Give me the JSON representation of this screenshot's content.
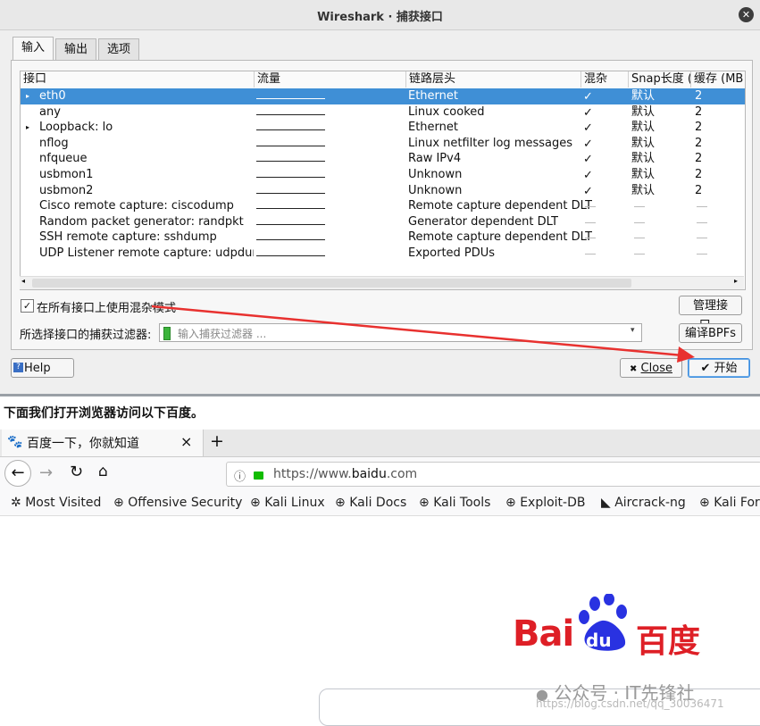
{
  "dialog": {
    "title": "Wireshark · 捕获接口",
    "tabs": [
      {
        "label": "输入"
      },
      {
        "label": "输出"
      },
      {
        "label": "选项"
      }
    ],
    "columns": {
      "interface": "接口",
      "traffic": "流量",
      "link_layer": "链路层头",
      "promiscuous": "混杂",
      "snaplen": "Snap长度 (B",
      "buffer": "缓存 (MB"
    },
    "rows": [
      {
        "expand": "▸",
        "name": "eth0",
        "link": "Ethernet",
        "promisc": "✓",
        "snap": "默认",
        "buffer": "2",
        "selected": true
      },
      {
        "expand": "",
        "name": "any",
        "link": "Linux cooked",
        "promisc": "✓",
        "snap": "默认",
        "buffer": "2"
      },
      {
        "expand": "▸",
        "name": "Loopback: lo",
        "link": "Ethernet",
        "promisc": "✓",
        "snap": "默认",
        "buffer": "2"
      },
      {
        "expand": "",
        "name": "nflog",
        "link": "Linux netfilter log messages",
        "promisc": "✓",
        "snap": "默认",
        "buffer": "2"
      },
      {
        "expand": "",
        "name": "nfqueue",
        "link": "Raw IPv4",
        "promisc": "✓",
        "snap": "默认",
        "buffer": "2"
      },
      {
        "expand": "",
        "name": "usbmon1",
        "link": "Unknown",
        "promisc": "✓",
        "snap": "默认",
        "buffer": "2"
      },
      {
        "expand": "",
        "name": "usbmon2",
        "link": "Unknown",
        "promisc": "✓",
        "snap": "默认",
        "buffer": "2"
      },
      {
        "expand": "",
        "name": "Cisco remote capture: ciscodump",
        "link": "Remote capture dependent DLT",
        "promisc": "",
        "snap": "",
        "buffer": ""
      },
      {
        "expand": "",
        "name": "Random packet generator: randpkt",
        "link": "Generator dependent DLT",
        "promisc": "",
        "snap": "",
        "buffer": ""
      },
      {
        "expand": "",
        "name": "SSH remote capture: sshdump",
        "link": "Remote capture dependent DLT",
        "promisc": "",
        "snap": "",
        "buffer": ""
      },
      {
        "expand": "",
        "name": "UDP Listener remote capture: udpdump",
        "link": "Exported PDUs",
        "promisc": "",
        "snap": "",
        "buffer": ""
      }
    ],
    "promisc_all_label": "在所有接口上使用混杂模式",
    "promisc_all_checked": "✓",
    "manage_button": "管理接口...",
    "filter_label": "所选择接口的捕获过滤器:",
    "filter_placeholder": "输入捕获过滤器 ...",
    "compile_button": "编译BPFs",
    "help_button": "Help",
    "close_button": "Close",
    "start_button": "开始",
    "annotation_arrow_color": "#e8312f",
    "selection_color": "#3f8fd6"
  },
  "blog": {
    "text": "下面我们打开浏览器访问以下百度。"
  },
  "browser": {
    "tab_title": "百度一下，你就知道",
    "tab_close": "×",
    "new_tab": "+",
    "url_prefix": "https://www.",
    "url_domain": "baidu",
    "url_suffix": ".com",
    "bookmarks": [
      {
        "label": "Most Visited",
        "icon": "gear-icon"
      },
      {
        "label": "Offensive Security",
        "icon": "globe-icon"
      },
      {
        "label": "Kali Linux",
        "icon": "globe-icon"
      },
      {
        "label": "Kali Docs",
        "icon": "globe-icon"
      },
      {
        "label": "Kali Tools",
        "icon": "globe-icon"
      },
      {
        "label": "Exploit-DB",
        "icon": "globe-icon"
      },
      {
        "label": "Aircrack-ng",
        "icon": "aircrack-icon"
      },
      {
        "label": "Kali For",
        "icon": "globe-icon"
      }
    ],
    "logo_text_left": "Bai",
    "logo_paw_text": "du",
    "logo_text_right": "百度",
    "logo_red": "#de1f26",
    "logo_blue": "#2932e1"
  },
  "watermark": {
    "main": "公众号 · IT先锋社",
    "url": "https://blog.csdn.net/qq_30036471"
  }
}
